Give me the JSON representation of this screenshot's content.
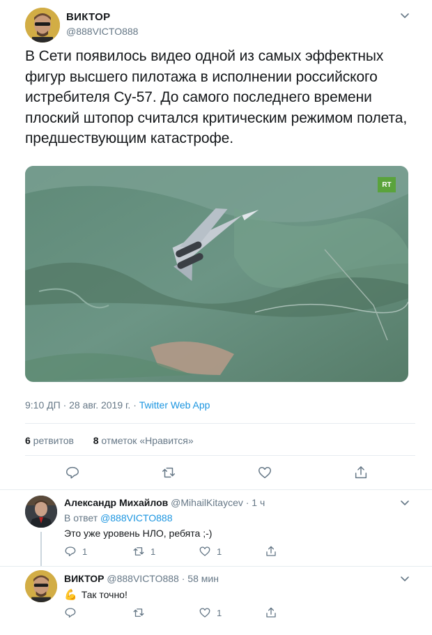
{
  "main_tweet": {
    "author_name": "ВИКТОР",
    "author_handle": "@888VICTO888",
    "text": "В Сети появилось видео одной из самых эффектных фигур высшего пилотажа в исполнении российского истребителя Су-57. До самого последнего времени плоский штопор считался критическим режимом полета, предшествующим катастрофе.",
    "media_badge": "RT",
    "timestamp": "9:10 ДП · 28 авг. 2019 г. · ",
    "source": "Twitter Web App",
    "retweets_count": "6",
    "retweets_label": " ретвитов",
    "likes_count": "8",
    "likes_label": " отметок «Нравится»",
    "actions": [
      "reply-icon",
      "retweet-icon",
      "like-icon",
      "share-icon"
    ]
  },
  "replies": [
    {
      "author_name": "Александр Михайлов",
      "author_handle": "@MihailKitaycev",
      "time": " · 1 ч",
      "reply_to_prefix": "В ответ ",
      "reply_to_handle": "@888VICTO888",
      "text": "Это уже уровень НЛО, ребята ;-)",
      "reply_count": "1",
      "retweet_count": "1",
      "like_count": "1"
    },
    {
      "author_name": "ВИКТОР",
      "author_handle": "@888VICTO888",
      "time": " · 58 мин",
      "text": "Так точно!",
      "emoji": "💪",
      "reply_count": "",
      "retweet_count": "",
      "like_count": "1"
    }
  ],
  "colors": {
    "link": "#1b95e0",
    "muted": "#657786",
    "divider": "#e6ecf0",
    "text": "#14171a"
  }
}
